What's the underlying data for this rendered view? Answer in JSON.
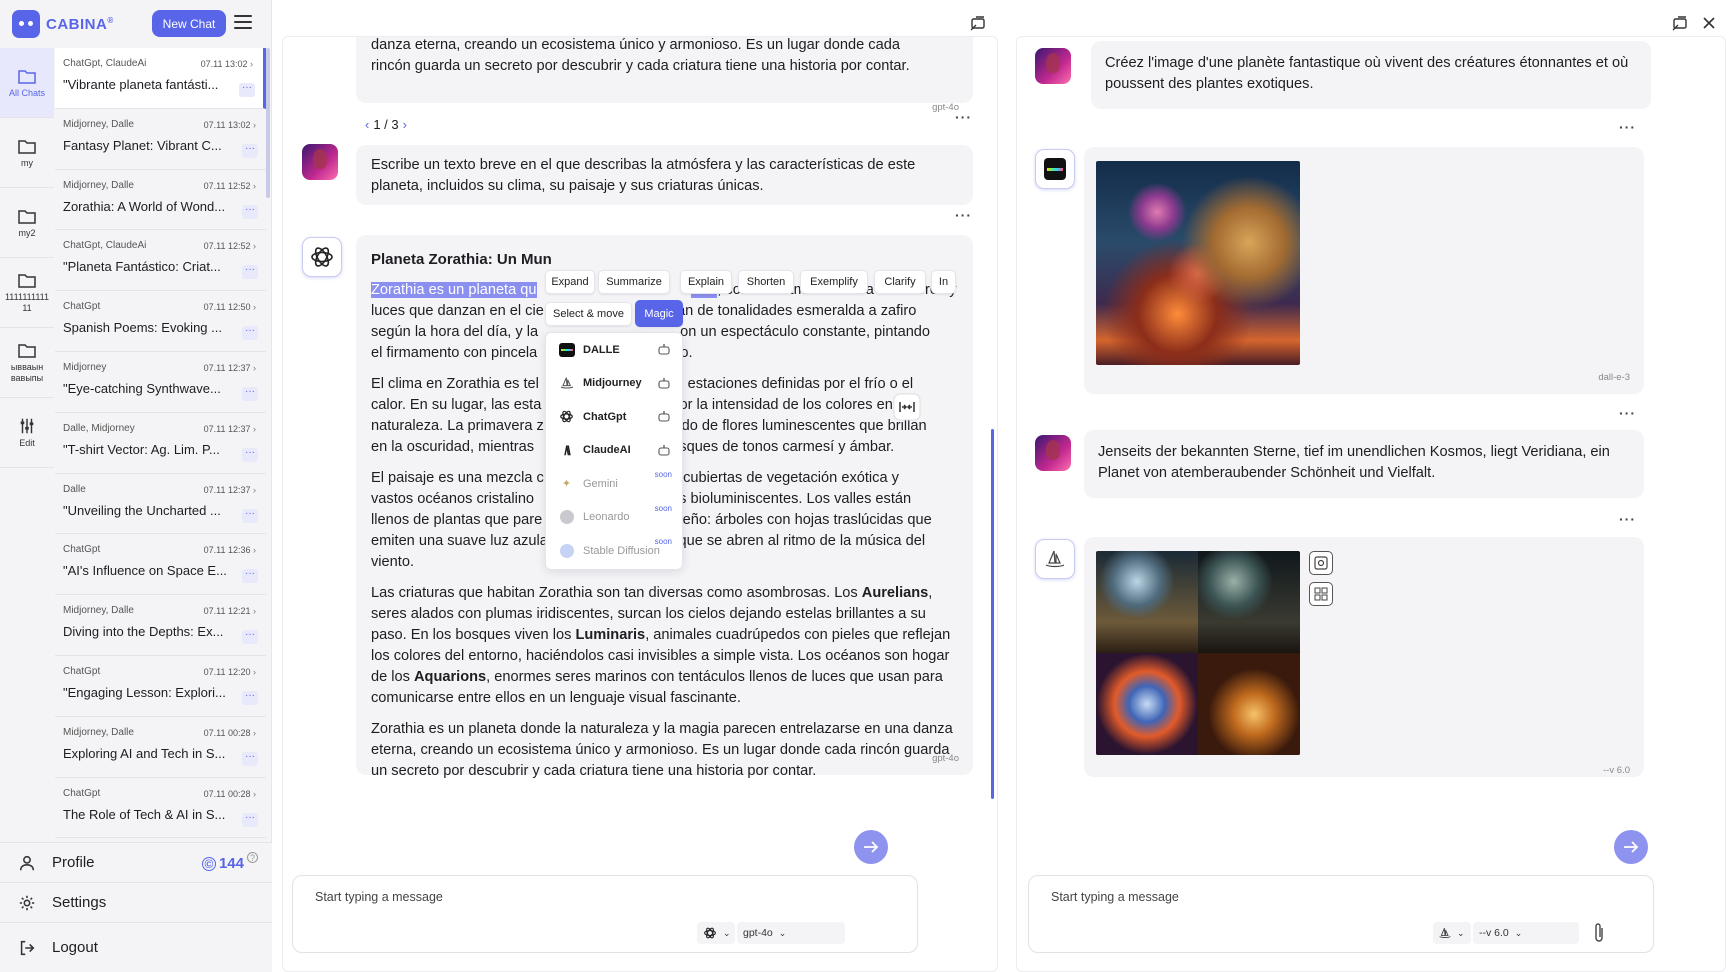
{
  "app": {
    "logo_text": "CABINA",
    "logo_sup": "®",
    "new_chat_label": "New Chat"
  },
  "folders": [
    {
      "label": "All Chats",
      "icon": "folders-icon"
    },
    {
      "label": "my",
      "icon": "folder-icon"
    },
    {
      "label": "my2",
      "icon": "folder-icon"
    },
    {
      "label": "1111111111\n11",
      "icon": "folder-icon"
    },
    {
      "label": "ывваын\nвавыпы",
      "icon": "folder-icon"
    },
    {
      "label": "Edit",
      "icon": "sliders-icon"
    }
  ],
  "chats": [
    {
      "models": "ChatGpt, ClaudeAi",
      "time": "07.11 13:02",
      "title": "\"Vibrante planeta fantásti..."
    },
    {
      "models": "Midjorney, Dalle",
      "time": "07.11 13:02",
      "title": "Fantasy Planet: Vibrant C..."
    },
    {
      "models": "Midjorney, Dalle",
      "time": "07.11 12:52",
      "title": "Zorathia: A World of Wond..."
    },
    {
      "models": "ChatGpt, ClaudeAi",
      "time": "07.11 12:52",
      "title": "\"Planeta Fantástico: Criat..."
    },
    {
      "models": "ChatGpt",
      "time": "07.11 12:50",
      "title": "Spanish Poems: Evoking ..."
    },
    {
      "models": "Midjorney",
      "time": "07.11 12:37",
      "title": "\"Eye-catching Synthwave..."
    },
    {
      "models": "Dalle, Midjorney",
      "time": "07.11 12:37",
      "title": "\"T-shirt Vector: Ag. Lim. P..."
    },
    {
      "models": "Dalle",
      "time": "07.11 12:37",
      "title": "\"Unveiling the Uncharted ..."
    },
    {
      "models": "ChatGpt",
      "time": "07.11 12:36",
      "title": "\"AI's Influence on Space E..."
    },
    {
      "models": "Midjorney, Dalle",
      "time": "07.11 12:21",
      "title": "Diving into the Depths: Ex..."
    },
    {
      "models": "ChatGpt",
      "time": "07.11 12:20",
      "title": "\"Engaging Lesson: Explori..."
    },
    {
      "models": "Midjorney, Dalle",
      "time": "07.11 00:28",
      "title": "Exploring AI and Tech in S..."
    },
    {
      "models": "ChatGpt",
      "time": "07.11 00:28",
      "title": "The Role of Tech & AI in S..."
    }
  ],
  "bottom": {
    "profile": "Profile",
    "credits": "144",
    "settings": "Settings",
    "logout": "Logout"
  },
  "left_panel": {
    "prev_text_1": "danza eterna, creando un ecosistema único y armonioso. Es un lugar donde cada",
    "prev_text_2": "rincón guarda un secreto por descubrir y cada criatura tiene una historia por contar.",
    "prev_model": "gpt-4o",
    "pager": "1 / 3",
    "user_prompt": "Escribe un texto breve en el que describas la atmósfera y las características de este planeta, incluidos su clima, su paisaje y sus criaturas únicas.",
    "title": "Planeta Zorathia: Un Mun",
    "p1_hl": "Zorathia es un planeta qu",
    "p1_hl2": "ción",
    "p1_a": ", con una atmósfera rica en colores y",
    "p1_l2a": "luces que danzan en el cie",
    "p1_l2b": "ian de tonalidades esmeralda a zafiro",
    "p1_l3a": "según la hora del día, y la",
    "p1_l3b": "on un espectáculo constante, pintando",
    "p1_l4a": "el firmamento con pincela",
    "p1_l4b": "rado.",
    "p2_l1a": "El clima en Zorathia es tel",
    "p2_l1b": "sin estaciones definidas por el frío o el",
    "p2_l2a": "calor. En su lugar, las esta",
    "p2_l2b": "por la intensidad de los colores en la",
    "p2_l3a": "naturaleza. La primavera z",
    "p2_l3b": "allido de flores luminescentes que brillan",
    "p2_l4a": "en la oscuridad, mientras",
    "p2_l4b": "bosques de tonos carmesí y ámbar.",
    "p3_l1a": "El paisaje es una mezcla c",
    "p3_l1b": "s cubiertas de vegetación exótica y",
    "p3_l2a": "vastos océanos cristalino",
    "p3_l2b": "uras bioluminiscentes. Los valles están",
    "p3_l3a": "llenos de plantas que pare",
    "p3_l3b": "sueño: árboles con hojas traslúcidas que",
    "p3_l4": "emiten una suave luz azulada y flores gigantes que se abren al ritmo de la música del",
    "p3_l5": "viento.",
    "p4_a": "Las criaturas que habitan Zorathia son tan diversas como asombrosas. Los ",
    "p4_b1": "Aurelians",
    "p4_c": ", seres alados con plumas iridiscentes, surcan los cielos dejando estelas brillantes a su paso. En los bosques viven los ",
    "p4_b2": "Luminaris",
    "p4_d": ", animales cuadrúpedos con pieles que reflejan los colores del entorno, haciéndolos casi invisibles a simple vista. Los océanos son hogar de los ",
    "p4_b3": "Aquarions",
    "p4_e": ", enormes seres marinos con tentáculos llenos de luces que usan para comunicarse entre ellos en un lenguaje visual fascinante.",
    "p5": "Zorathia es un planeta donde la naturaleza y la magia parecen entrelazarse en una danza eterna, creando un ecosistema único y armonioso. Es un lugar donde cada rincón guarda un secreto por descubrir y cada criatura tiene una historia por contar.",
    "model": "gpt-4o",
    "input_placeholder": "Start typing a message",
    "selected_model": "gpt-4o"
  },
  "toolbar": {
    "buttons": [
      "Expand",
      "Summarize",
      "Explain",
      "Shorten",
      "Exemplify",
      "Clarify",
      "In"
    ],
    "select_move": "Select & move",
    "magic": "Magic"
  },
  "magic_menu": [
    {
      "label": "DALLE",
      "state": "enabled"
    },
    {
      "label": "Midjourney",
      "state": "enabled"
    },
    {
      "label": "ChatGpt",
      "state": "enabled"
    },
    {
      "label": "ClaudeAI",
      "state": "enabled"
    },
    {
      "label": "Gemini",
      "state": "soon"
    },
    {
      "label": "Leonardo",
      "state": "soon"
    },
    {
      "label": "Stable Diffusion",
      "state": "soon"
    }
  ],
  "soon_label": "soon",
  "right_panel": {
    "prompt1": "Créez l'image d'une planète fantastique où vivent des créatures étonnantes et où poussent des plantes exotiques.",
    "model1": "dall-e-3",
    "prompt2": "Jenseits der bekannten Sterne, tief im unendlichen Kosmos, liegt Veridiana, ein Planet von atemberaubender Schönheit und Vielfalt.",
    "model2": "--v 6.0",
    "input_placeholder": "Start typing a message",
    "selected_version": "--v 6.0"
  },
  "colors": {
    "accent": "#5865e8",
    "bubble": "#f4f4f7",
    "sidebar": "#f4f4f7"
  }
}
